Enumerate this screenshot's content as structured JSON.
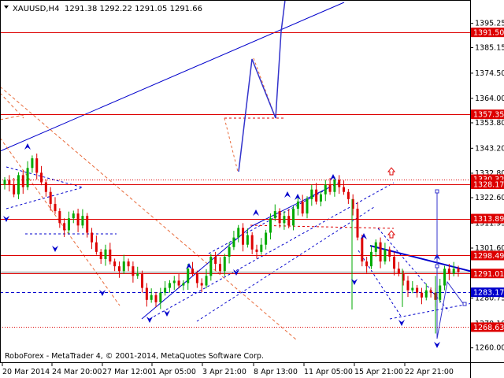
{
  "header": {
    "symbol": "XAUUSD,H4",
    "ohlc": "1291.38 1292.22 1291.05 1291.66"
  },
  "footer": {
    "copyright": "RoboForex - MetaTrader 4, © 2001-2014, MetaQuotes Software Corp."
  },
  "chart_data": {
    "type": "candlestick",
    "title": "XAUUSD,H4",
    "ylim": [
      1254,
      1405
    ],
    "x_ticks": [
      "20 Mar 2014",
      "24 Mar 20:00",
      "27 Mar 12:00",
      "1 Apr 05:00",
      "3 Apr 21:00",
      "8 Apr 13:00",
      "11 Apr 05:00",
      "15 Apr 21:00",
      "22 Apr 21:00"
    ],
    "y_ticks": [
      "1395.25",
      "1385.15",
      "1374.50",
      "1364.00",
      "1353.80",
      "1343.20",
      "1332.80",
      "1322.60",
      "1311.95",
      "1301.60",
      "1290.95",
      "1280.75",
      "1270.10",
      "1260.00"
    ],
    "levels": [
      {
        "label": "1391.50",
        "value": 1391.5,
        "color": "#dd0000",
        "style": "solid"
      },
      {
        "label": "1357.35",
        "value": 1357.35,
        "color": "#dd0000",
        "style": "solid"
      },
      {
        "label": "1330.32",
        "value": 1330.32,
        "color": "#dd0000",
        "style": "dotted"
      },
      {
        "label": "1328.17",
        "value": 1328.17,
        "color": "#dd0000",
        "style": "solid"
      },
      {
        "label": "1313.89",
        "value": 1313.89,
        "color": "#dd0000",
        "style": "solid"
      },
      {
        "label": "1298.49",
        "value": 1298.49,
        "color": "#dd0000",
        "style": "solid"
      },
      {
        "label": "1291.01",
        "value": 1291.01,
        "color": "#dd0000",
        "style": "solid"
      },
      {
        "label": "1283.17",
        "value": 1283.17,
        "color": "#0000cc",
        "style": "dashed"
      },
      {
        "label": "1268.63",
        "value": 1268.63,
        "color": "#dd0000",
        "style": "dotted"
      }
    ],
    "current_price": 1291.66,
    "colors": {
      "bull": "#00aa00",
      "bear": "#dd0000",
      "trend": "#0000cc",
      "channel": "#e86a3a",
      "forecast": "#3333cc"
    },
    "closes": [
      1330,
      1328,
      1324,
      1332,
      1327,
      1335,
      1339,
      1333,
      1329,
      1325,
      1320,
      1317,
      1312,
      1309,
      1314,
      1316,
      1311,
      1315,
      1308,
      1304,
      1300,
      1297,
      1301,
      1296,
      1294,
      1292,
      1296,
      1294,
      1290,
      1291,
      1285,
      1280,
      1282,
      1279,
      1283,
      1285,
      1287,
      1288,
      1286,
      1287,
      1293,
      1291,
      1287,
      1286,
      1290,
      1298,
      1295,
      1292,
      1298,
      1302,
      1306,
      1310,
      1303,
      1307,
      1301,
      1300,
      1303,
      1308,
      1314,
      1317,
      1312,
      1315,
      1311,
      1318,
      1321,
      1316,
      1322,
      1326,
      1321,
      1324,
      1328,
      1325,
      1330,
      1327,
      1325,
      1322,
      1318,
      1306,
      1296,
      1294,
      1300,
      1304,
      1296,
      1301,
      1298,
      1293,
      1291,
      1288,
      1284,
      1285,
      1283,
      1281,
      1284,
      1283,
      1280,
      1286,
      1293,
      1291,
      1293,
      1291.66
    ]
  }
}
